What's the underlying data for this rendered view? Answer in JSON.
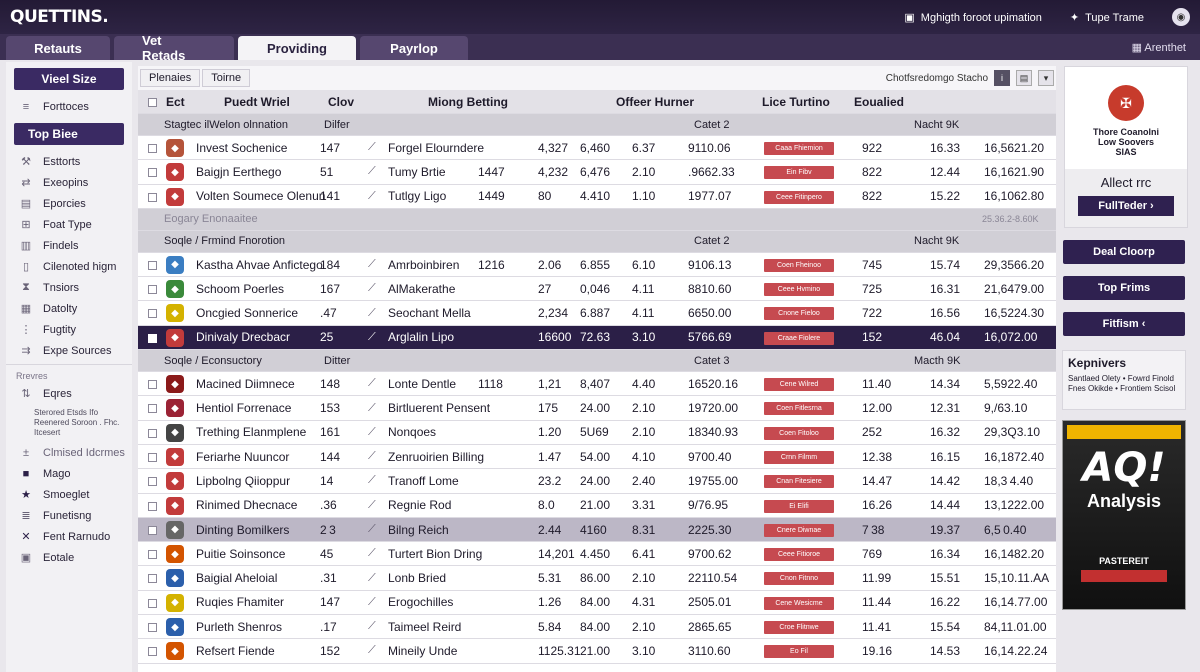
{
  "app": {
    "logo": "QUETTINS.",
    "top_right_1": "Mghigth foroot upimation",
    "top_right_2": "Tupe Trame"
  },
  "tabs": [
    {
      "label": "Retauts"
    },
    {
      "label": "Vet Retads"
    },
    {
      "label": "Providing",
      "active": true
    },
    {
      "label": "Payrlop"
    }
  ],
  "tab_right": "Arenthet",
  "sidebar": {
    "btn1": "Vieel Size",
    "item1": "Forttoces",
    "btn2": "Top Biee",
    "items": [
      "Esttorts",
      "Exeopins",
      "Eporcies",
      "Foat Type",
      "Findels",
      "Cilenoted higm",
      "Tnsiors",
      "Datolty",
      "Fugtity",
      "Expe Sources"
    ],
    "head1": "Rrevres",
    "item_e": "Eqres",
    "desc": "Sterored  Etsds Ifo Reenered  Soroon . Fhc. Itcesert",
    "sub": "Clmised Idcrmes",
    "items2": [
      "Mago",
      "Smoeglet",
      "Funetisng",
      "Fent Rarnudo",
      "Eotale"
    ]
  },
  "subbar": {
    "tab1": "Plenaies",
    "tab2": "Toirne",
    "right": "Chotfsredomgo Stacho"
  },
  "table": {
    "headers": {
      "ect": "Ect",
      "name": "Puedt Wriel",
      "a": "Clov",
      "act": "Miong Betting",
      "d": "Offeer Hurner",
      "btn": "Lice Turtino",
      "g": "Eoualied"
    },
    "groups": [
      {
        "l": "Stagtec ilWelon olnnation",
        "m": "Dilfer",
        "c": "Catet 2",
        "r": "Nacht 9K"
      },
      {
        "l": "Soqle / Frmind Fnorotion",
        "c": "Catet 2",
        "r": "Nacht 9K"
      },
      {
        "l": "Soqle / Econsuctory",
        "m": "Ditter",
        "c": "Catet 3",
        "r": "Macth 9K"
      }
    ],
    "dim": {
      "name": "Eogary Enonaaitee",
      "right": "25.36.2-8.60K"
    },
    "rows": [
      {
        "name": "Invest Sochenice",
        "a": "147",
        "act": "Forgel Elourndere",
        "b": "",
        "c": "4,327",
        "d": "6,460",
        "e": "6.37",
        "f": "9110.06",
        "btn": "Caaa Fhiemion",
        "g": "922",
        "h": "16.33",
        "i": "16,5621.20",
        "crest": "#b5543a"
      },
      {
        "name": "Baigjn Eerthego",
        "a": "51",
        "act": "Tumy Brtie",
        "b": "1447",
        "c": "4,232",
        "d": "6,476",
        "e": "2.10",
        "f": ".9662.33",
        "btn": "Ein Fibv",
        "g": "822",
        "h": "12.44",
        "i": "16,1621.90",
        "crest": "#c23b3b"
      },
      {
        "name": "Volten Soumece Olenun",
        "a": "141",
        "act": "Tutlgy Ligo",
        "b": "1449",
        "c": "80",
        "d": "4.410",
        "e": "1.10",
        "f": "1977.07",
        "btn": "Ceee Fitinpero",
        "g": "822",
        "h": "15.22",
        "i": "16,1062.80",
        "crest": "#c23b3b"
      },
      {
        "name": "Kastha Ahvae Anfictego",
        "a": "184",
        "act": "Amrboinbiren",
        "b": "1216",
        "c": "2.06",
        "d": "6.855",
        "e": "6.10",
        "f": "9106.13",
        "btn": "Coen Fheinoo",
        "g": "745",
        "h": "15.74",
        "i": "29,3566.20",
        "crest": "#3b7ec2"
      },
      {
        "name": "Schoom Poerles",
        "a": "167",
        "act": "AlMakerathe",
        "b": "",
        "c": "27",
        "d": "0,046",
        "e": "4.11",
        "f": "8810.60",
        "btn": "Ceee Hvmino",
        "g": "725",
        "h": "16.31",
        "i": "21,6479.00",
        "crest": "#3a8a3a"
      },
      {
        "name": "Oncgied Sonnerice",
        "a": ".47",
        "act": "Seochant Mella",
        "b": "",
        "c": "2,234",
        "d": "6.887",
        "e": "4.11",
        "f": "6650.00",
        "btn": "Cnone Fieloo",
        "g": "722",
        "h": "16.56",
        "i": "16,5224.30",
        "crest": "#d4b200"
      },
      {
        "name": "Dinivaly Drecbacr",
        "a": "25",
        "act": "Arglalin Lipo",
        "b": "",
        "c": "16600",
        "d": "72.63",
        "e": "3.10",
        "f": "5766.69",
        "btn": "Craae Fiolere",
        "g": "152",
        "h": "46.04",
        "i": "16,072.00",
        "crest": "#c23b3b",
        "sel": true
      },
      {
        "name": "Macined Diimnece",
        "a": "148",
        "act": "Lonte Dentle",
        "b": "1118",
        "c": "1,21",
        "d": "8,407",
        "e": "4.40",
        "f": "16520.16",
        "btn": "Cene Wilred",
        "g": "11.40",
        "h": "14.34",
        "i": "5,5922.40",
        "crest": "#8b1a1a"
      },
      {
        "name": "Hentiol Forrenace",
        "a": "153",
        "act": "Birtluerent Pensent",
        "b": "",
        "c": "175",
        "d": "24.00",
        "e": "2.10",
        "f": "19720.00",
        "btn": "Coen Fitlesrna",
        "g": "12.00",
        "h": "12.31",
        "i": "9,/63.10",
        "crest": "#9b2335"
      },
      {
        "name": "Trething Elanmplene",
        "a": "161",
        "act": "Nonqoes",
        "b": "",
        "c": "1.20",
        "d": "5U69",
        "e": "2.10",
        "f": "18340.93",
        "btn": "Coen Fitoloo",
        "g": "252",
        "h": "16.32",
        "i": "29,3Q3.10",
        "crest": "#444"
      },
      {
        "name": "Feriarhe Nuuncor",
        "a": "144",
        "act": "Zenruoirien Billing",
        "b": "",
        "c": "1.47",
        "d": "54.00",
        "e": "4.10",
        "f": "9700.40",
        "btn": "Crnn Filmm",
        "g": "12.38",
        "h": "16.15",
        "i": "16,1872.40",
        "crest": "#c23b3b"
      },
      {
        "name": "Lipbolng Qiioppur",
        "a": "14",
        "act": "Tranoff Lome",
        "b": "",
        "c": "23.2",
        "d": "24.00",
        "e": "2.40",
        "f": "19755.00",
        "btn": "Cnan Fitesiere",
        "g": "14.47",
        "h": "14.42",
        "i": "18,3 4.40",
        "crest": "#c23b3b"
      },
      {
        "name": "Rinimed Dhecnace",
        "a": ".36",
        "act": "Regnie Rod",
        "b": "",
        "c": "8.0",
        "d": "21.00",
        "e": "3.31",
        "f": "9/76.95",
        "btn": "Ei Elifi",
        "g": "16.26",
        "h": "14.44",
        "i": "13,1222.00",
        "crest": "#c23b3b"
      },
      {
        "name": "Dinting Bomilkers",
        "a": "2 3",
        "act": "Bilng Reich",
        "b": "",
        "c": "2.44",
        "d": "4160",
        "e": "8.31",
        "f": "2225.30",
        "btn": "Cnere Diwnae",
        "g": "7 38",
        "h": "19.37",
        "i": "6,5 0.40",
        "crest": "#666",
        "lite": true
      },
      {
        "name": "Puitie Soinsonce",
        "a": "45",
        "act": "Turtert Bion Dring",
        "b": "",
        "c": "14,201",
        "d": "4.450",
        "e": "6.41",
        "f": "9700.62",
        "btn": "Ceee Fitioroe",
        "g": "769",
        "h": "16.34",
        "i": "16,1482.20",
        "crest": "#d35400"
      },
      {
        "name": "Baigial Aheloial",
        "a": ".31",
        "act": "Lonb Bried",
        "b": "",
        "c": "5.31",
        "d": "86.00",
        "e": "2.10",
        "f": "22110.54",
        "btn": "Cnon Fitnno",
        "g": "11.99",
        "h": "15.51",
        "i": "15,10.11.AA",
        "crest": "#2b5fab"
      },
      {
        "name": "Ruqies Fhamiter",
        "a": "147",
        "act": "Erogochilles",
        "b": "",
        "c": "1.26",
        "d": "84.00",
        "e": "4.31",
        "f": "2505.01",
        "btn": "Cene Wesicme",
        "g": "11.44",
        "h": "16.22",
        "i": "16,14.77.00",
        "crest": "#d4b200"
      },
      {
        "name": "Purleth Shenros",
        "a": ".17",
        "act": "Taimeel Reird",
        "b": "",
        "c": "5.84",
        "d": "84.00",
        "e": "2.10",
        "f": "2865.65",
        "btn": "Croe Flitnwe",
        "g": "11.41",
        "h": "15.54",
        "i": "84,11.01.00",
        "crest": "#2b5fab"
      },
      {
        "name": "Refsert Fiende",
        "a": "152",
        "act": "Mineily Unde",
        "b": "",
        "c": "1125.31",
        "d": "21.00",
        "e": "3.10",
        "f": "3110.60",
        "btn": "Eo Fil",
        "g": "19.16",
        "h": "14.53",
        "i": "16,14.22.24",
        "crest": "#d35400"
      }
    ]
  },
  "panel": {
    "card_text": "Thore Coanolni\nLow Soovers\nSIAS",
    "card_sub": "Allect rrc",
    "card_btn": "FullTeder",
    "btn1": "Deal Cloorp",
    "btn2": "Top Frims",
    "btn3": "Fitfism",
    "kbox_title": "Kepnivers",
    "kbox_desc": "Santlaed Olety • Fowrd Finold Fnes Okikde • Frontiem Scisol",
    "ad_big": "AQ!",
    "ad_sub": "Analysis",
    "ad_foot": "PASTEREIT"
  }
}
